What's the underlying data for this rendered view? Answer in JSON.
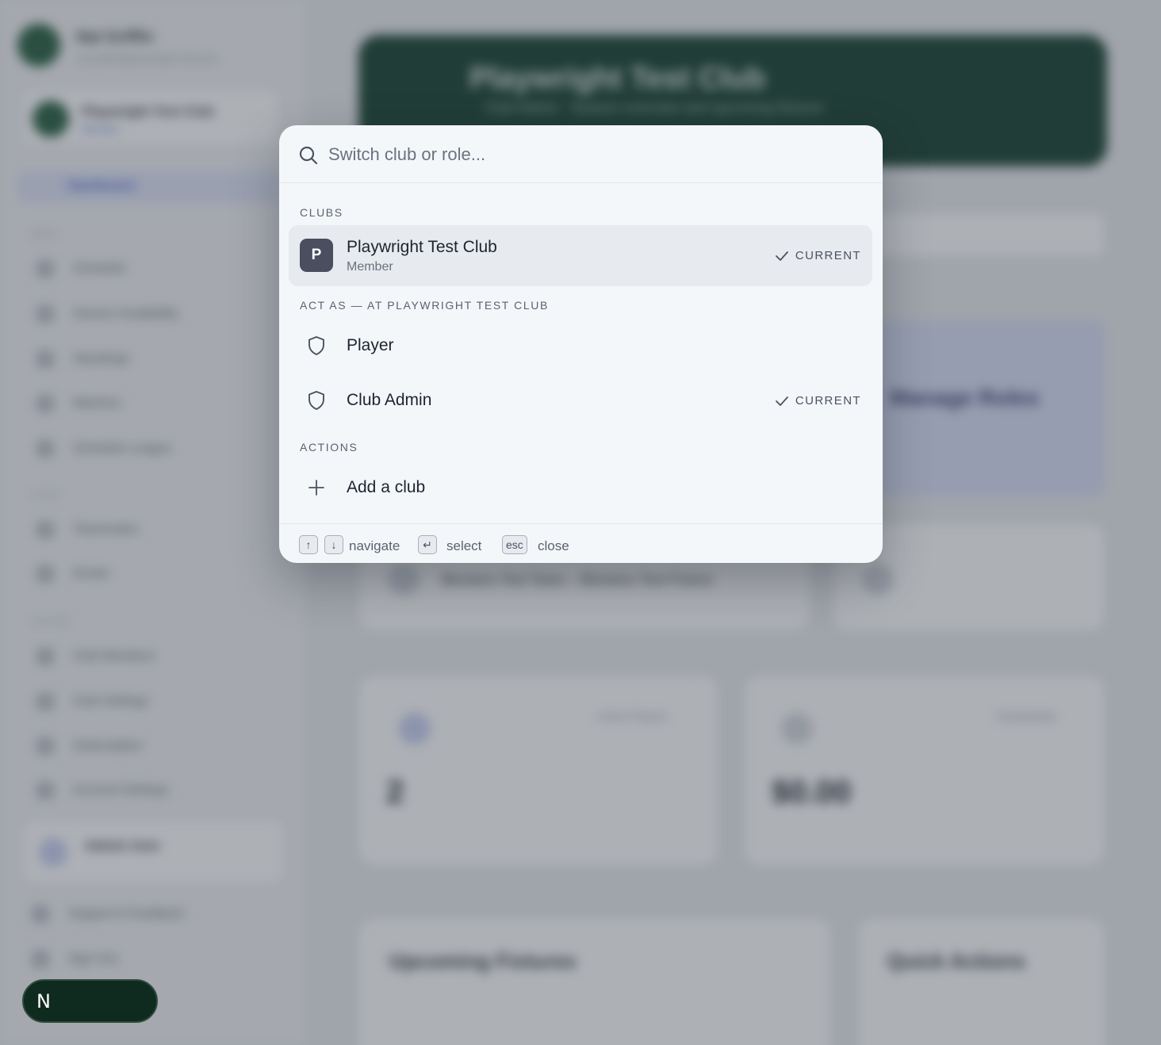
{
  "background": {
    "sidebar": {
      "user_name": "Nat Griffin",
      "user_email": "nat.griffin@playwright-club.test",
      "club_name": "Playwright Test Club",
      "club_role": "Member",
      "active_item": "Dashboard",
      "sections": [
        "MAIN",
        "CLUB",
        "PLAYER"
      ],
      "items": [
        "Schedule",
        "Season Availability",
        "Standings",
        "Matches",
        "Schedule League",
        "Teammates",
        "Roster",
        "Club Members",
        "Club Settings",
        "Subscription",
        "Account Settings"
      ],
      "footer_user": "Admin User",
      "footer_links": [
        "Support & Feedback",
        "Sign Out"
      ]
    },
    "hero": {
      "title": "Playwright Test Club",
      "subtitle": "Club Admin · Season overview and upcoming fixtures"
    },
    "cards": {
      "players_label": "Active Players",
      "players_value": "2",
      "balance_label": "Outstanding",
      "balance_value": "$0.00",
      "fixtures_title": "Upcoming Fixtures",
      "actions_title": "Quick Actions",
      "fixture_name": "Blockers Test Team – Blockers Test Fixture",
      "action_name": "Manage Roles"
    }
  },
  "palette": {
    "search": {
      "placeholder": "Switch club or role..."
    },
    "groups": {
      "clubs": "CLUBS",
      "act_as": "ACT AS — AT PLAYWRIGHT TEST CLUB",
      "actions": "ACTIONS"
    },
    "clubs": [
      {
        "initial": "P",
        "name": "Playwright Test Club",
        "role": "Member",
        "current": "CURRENT"
      }
    ],
    "roles": [
      {
        "name": "Player",
        "icon": "shield-icon",
        "current": ""
      },
      {
        "name": "Club Admin",
        "icon": "shield-icon",
        "current": "CURRENT"
      }
    ],
    "actions": [
      {
        "name": "Add a club",
        "icon": "plus-icon"
      }
    ],
    "footer": {
      "up_key": "↑",
      "down_key": "↓",
      "navigate": "navigate",
      "enter_key": "↵",
      "select": "select",
      "esc_key": "esc",
      "close": "close"
    }
  },
  "dev_badge": {
    "label": "N"
  },
  "colors": {
    "palette_bg": "#f4f7fa",
    "active_row": "#e7eaee",
    "club_badge": "#4a4e5e",
    "hero_green": "#0f3a27",
    "scrim": "rgba(60,66,78,0.42)"
  }
}
